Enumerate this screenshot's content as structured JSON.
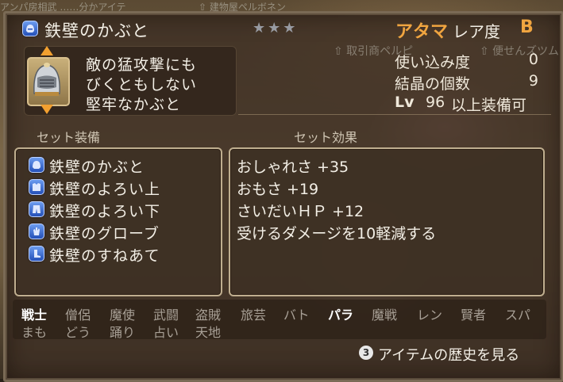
{
  "background_text": {
    "top_left": "アンパ房相武 ……分かアイテ",
    "top_center": "⇧ 建物屋ペルボネン",
    "right_1": "⇧ 取引商ペルピ",
    "right_2": "⇧ 便せんズツム"
  },
  "item": {
    "name": "鉄壁のかぶと",
    "stars": "★★★",
    "category": "アタマ",
    "rarity_label": "レア度",
    "rarity_value": "B",
    "description": [
      "敵の猛攻撃にも",
      "びくともしない",
      "堅牢なかぶと"
    ]
  },
  "stats": {
    "usage_label": "使い込み度",
    "usage_value": "0",
    "crystal_label": "結晶の個数",
    "crystal_value": "9",
    "lv_prefix": "Lv",
    "lv_value": "96",
    "lv_suffix": "以上装備可"
  },
  "set_equipment": {
    "heading": "セット装備",
    "items": [
      {
        "label": "鉄壁のかぶと",
        "icon": "helmet-icon"
      },
      {
        "label": "鉄壁のよろい上",
        "icon": "body-armor-icon"
      },
      {
        "label": "鉄壁のよろい下",
        "icon": "leg-armor-icon"
      },
      {
        "label": "鉄壁のグローブ",
        "icon": "glove-icon"
      },
      {
        "label": "鉄壁のすねあて",
        "icon": "boot-icon"
      }
    ]
  },
  "set_effects": {
    "heading": "セット効果",
    "items": [
      "おしゃれさ +35",
      "おもさ +19",
      "さいだいＨＰ +12",
      "受けるダメージを10軽減する"
    ]
  },
  "jobs": {
    "row1": [
      {
        "label": "戦士",
        "active": true
      },
      {
        "label": "僧侶",
        "active": false
      },
      {
        "label": "魔使",
        "active": false
      },
      {
        "label": "武闘",
        "active": false
      },
      {
        "label": "盗賊",
        "active": false
      },
      {
        "label": "旅芸",
        "active": false
      },
      {
        "label": "バト",
        "active": false
      },
      {
        "label": "パラ",
        "active": true
      },
      {
        "label": "魔戦",
        "active": false
      },
      {
        "label": "レン",
        "active": false
      },
      {
        "label": "賢者",
        "active": false
      },
      {
        "label": "スパ",
        "active": false
      }
    ],
    "row2": [
      {
        "label": "まも",
        "active": false
      },
      {
        "label": "どう",
        "active": false
      },
      {
        "label": "踊り",
        "active": false
      },
      {
        "label": "占い",
        "active": false
      },
      {
        "label": "天地",
        "active": false
      }
    ]
  },
  "history": {
    "button_glyph": "3",
    "label": "アイテムの歴史を見る"
  }
}
